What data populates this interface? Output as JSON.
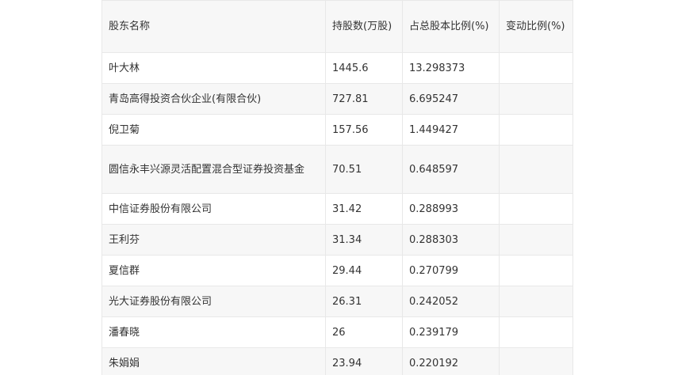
{
  "table": {
    "headers": [
      "股东名称",
      "持股数(万股)",
      "占总股本比例(%)",
      "变动比例(%)"
    ],
    "rows": [
      {
        "name": "叶大林",
        "shares": "1445.6",
        "ratio": "13.298373",
        "change": ""
      },
      {
        "name": "青岛高得投资合伙企业(有限合伙)",
        "shares": "727.81",
        "ratio": "6.695247",
        "change": ""
      },
      {
        "name": "倪卫菊",
        "shares": "157.56",
        "ratio": "1.449427",
        "change": ""
      },
      {
        "name": "圆信永丰兴源灵活配置混合型证券投资基金",
        "shares": "70.51",
        "ratio": "0.648597",
        "change": ""
      },
      {
        "name": "中信证券股份有限公司",
        "shares": "31.42",
        "ratio": "0.288993",
        "change": ""
      },
      {
        "name": "王利芬",
        "shares": "31.34",
        "ratio": "0.288303",
        "change": ""
      },
      {
        "name": "夏信群",
        "shares": "29.44",
        "ratio": "0.270799",
        "change": ""
      },
      {
        "name": "光大证券股份有限公司",
        "shares": "26.31",
        "ratio": "0.242052",
        "change": ""
      },
      {
        "name": "潘春晓",
        "shares": "26",
        "ratio": "0.239179",
        "change": ""
      },
      {
        "name": "朱娟娟",
        "shares": "23.94",
        "ratio": "0.220192",
        "change": ""
      }
    ]
  }
}
